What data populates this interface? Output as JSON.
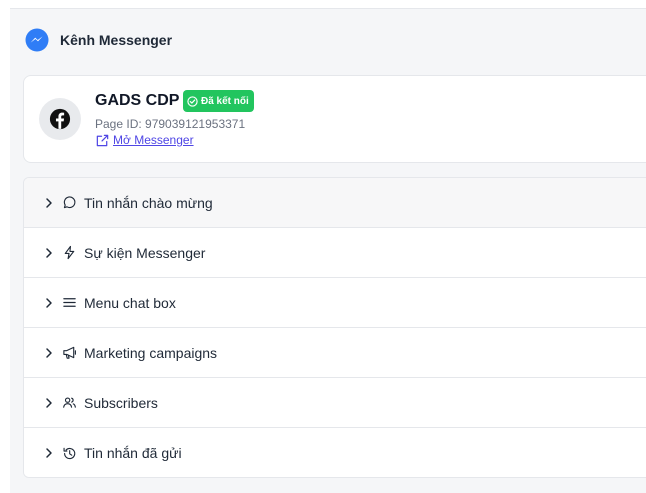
{
  "header": {
    "title": "Kênh Messenger",
    "icon": "messenger-icon",
    "brand_color": "#2f7df6"
  },
  "page": {
    "name": "GADS CDP",
    "status_badge": "Đã kết nối",
    "status_color": "#22c55e",
    "page_id": "Page ID: 979039121953371",
    "open_link_label": "Mở Messenger",
    "avatar_icon": "facebook-icon"
  },
  "sections": [
    {
      "label": "Tin nhắn chào mừng",
      "icon": "message-circle-icon"
    },
    {
      "label": "Sự kiện Messenger",
      "icon": "lightning-icon"
    },
    {
      "label": "Menu chat box",
      "icon": "menu-icon"
    },
    {
      "label": "Marketing campaigns",
      "icon": "megaphone-icon"
    },
    {
      "label": "Subscribers",
      "icon": "users-icon"
    },
    {
      "label": "Tin nhắn đã gửi",
      "icon": "history-icon"
    }
  ]
}
